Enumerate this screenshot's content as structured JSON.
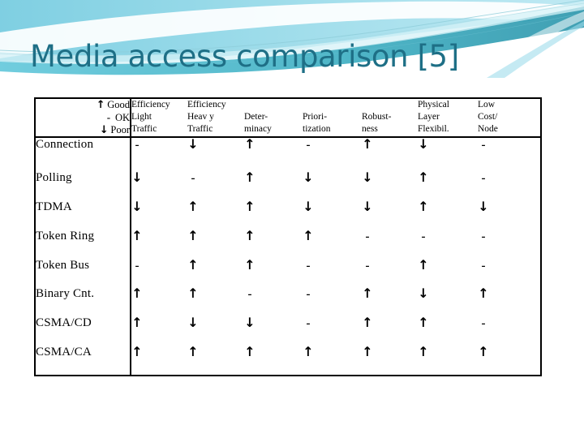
{
  "slide": {
    "title": "Media access comparison [5]",
    "title_color": "#1e6f86",
    "background": "#ffffff",
    "banner_colors": {
      "sky": "#8fd3e4",
      "deep_teal": "#2fa8bd",
      "mid_teal": "#5fc6d8",
      "pale": "#e8f7fa",
      "white": "#ffffff"
    }
  },
  "legend": {
    "good": {
      "symbol": "↑",
      "label": "Good"
    },
    "ok": {
      "symbol": "-",
      "label": "OK"
    },
    "poor": {
      "symbol": "↓",
      "label": "Poor"
    }
  },
  "table": {
    "columns": [
      {
        "id": "eff_light",
        "lines": [
          "Efficiency",
          "Light",
          "Traffic"
        ]
      },
      {
        "id": "eff_heavy",
        "lines": [
          "Efficiency",
          "Heav y",
          "Traffic"
        ]
      },
      {
        "id": "determinacy",
        "lines": [
          "",
          "Deter-",
          "minacy"
        ]
      },
      {
        "id": "prioritization",
        "lines": [
          "",
          "Priori-",
          "tization"
        ]
      },
      {
        "id": "robustness",
        "lines": [
          "",
          "Robust-",
          "ness"
        ]
      },
      {
        "id": "phy_flex",
        "lines": [
          "Physical",
          "Layer",
          "Flexibil."
        ]
      },
      {
        "id": "low_cost",
        "lines": [
          "Low",
          "Cost/",
          "Node"
        ]
      }
    ],
    "rows": [
      {
        "label": "Connection",
        "values": [
          "-",
          "↓",
          "↑",
          "-",
          "↑",
          "↓",
          "-"
        ]
      },
      {
        "label": "Polling",
        "values": [
          "↓",
          "-",
          "↑",
          "↓",
          "↓",
          "↑",
          "-"
        ]
      },
      {
        "label": "TDMA",
        "values": [
          "↓",
          "↑",
          "↑",
          "↓",
          "↓",
          "↑",
          "↓"
        ]
      },
      {
        "label": "Token Ring",
        "values": [
          "↑",
          "↑",
          "↑",
          "↑",
          "-",
          "-",
          "-"
        ]
      },
      {
        "label": "Token Bus",
        "values": [
          "-",
          "↑",
          "↑",
          "-",
          "-",
          "↑",
          "-"
        ]
      },
      {
        "label": "Binary Cnt.",
        "values": [
          "↑",
          "↑",
          "-",
          "-",
          "↑",
          "↓",
          "↑"
        ]
      },
      {
        "label": "CSMA/CD",
        "values": [
          "↑",
          "↓",
          "↓",
          "-",
          "↑",
          "↑",
          "-"
        ]
      },
      {
        "label": "CSMA/CA",
        "values": [
          "↑",
          "↑",
          "↑",
          "↑",
          "↑",
          "↑",
          "↑"
        ]
      }
    ]
  }
}
